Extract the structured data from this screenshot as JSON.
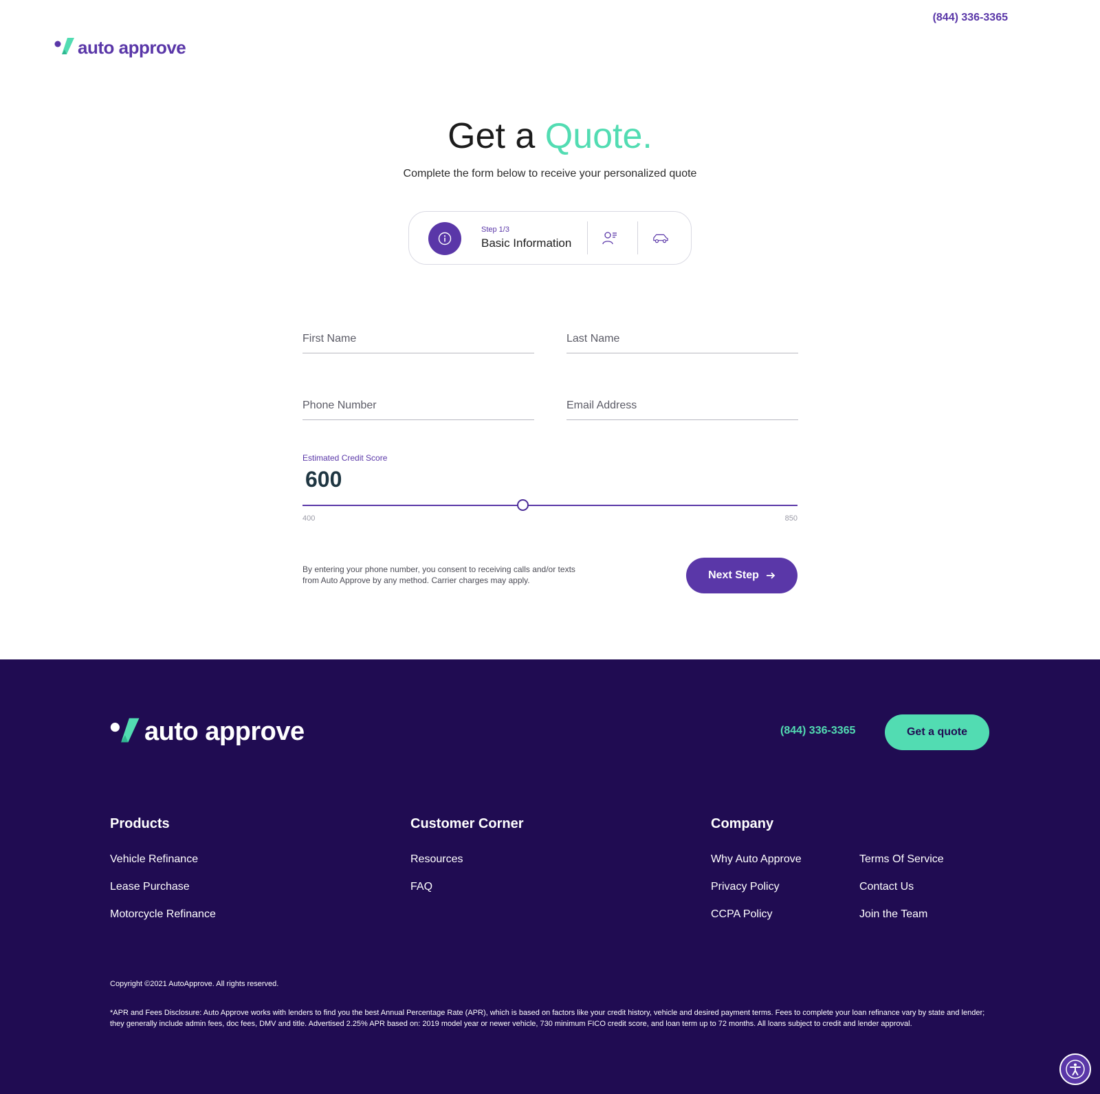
{
  "header": {
    "phone": "(844) 336-3365",
    "logo_text": "auto approve"
  },
  "hero": {
    "title_plain": "Get a ",
    "title_accent": "Quote.",
    "subtitle": "Complete the form below to receive your personalized quote"
  },
  "stepper": {
    "step_counter": "Step 1/3",
    "step_title": "Basic Information",
    "icons": [
      "info-icon",
      "person-list-icon",
      "car-icon"
    ]
  },
  "form": {
    "first_name_placeholder": "First Name",
    "last_name_placeholder": "Last Name",
    "phone_placeholder": "Phone Number",
    "email_placeholder": "Email Address",
    "credit_label": "Estimated Credit Score",
    "credit_value": "600",
    "credit_min": "400",
    "credit_max": "850",
    "consent_line1": "By entering your phone number, you consent to receiving calls and/or texts",
    "consent_line2": "from Auto Approve by any method. Carrier charges may apply.",
    "next_label": "Next Step"
  },
  "footer": {
    "logo_text": "auto approve",
    "phone": "(844) 336-3365",
    "cta_label": "Get a quote",
    "columns": {
      "products": {
        "title": "Products",
        "links": [
          "Vehicle Refinance",
          "Lease Purchase",
          "Motorcycle Refinance"
        ]
      },
      "customer": {
        "title": "Customer Corner",
        "links": [
          "Resources",
          "FAQ"
        ]
      },
      "company": {
        "title": "Company",
        "links_a": [
          "Why Auto Approve",
          "Privacy Policy",
          "CCPA Policy"
        ],
        "links_b": [
          "Terms Of Service",
          "Contact Us",
          "Join the Team"
        ]
      }
    },
    "copyright": "Copyright ©2021 AutoApprove. All rights reserved.",
    "disclaimer": "*APR and Fees Disclosure: Auto Approve works with lenders to find you the best Annual Percentage Rate (APR), which is based on factors like your credit history, vehicle and desired payment terms. Fees to complete your loan refinance vary by state and lender; they generally include admin fees, doc fees, DMV and title. Advertised 2.25% APR based on: 2019 model year or newer vehicle, 730 minimum FICO credit score, and loan term up to 72 months. All loans subject to credit and lender approval."
  },
  "colors": {
    "brand_purple": "#5a37a8",
    "accent_mint": "#52dcb2",
    "footer_bg": "#200c52"
  }
}
